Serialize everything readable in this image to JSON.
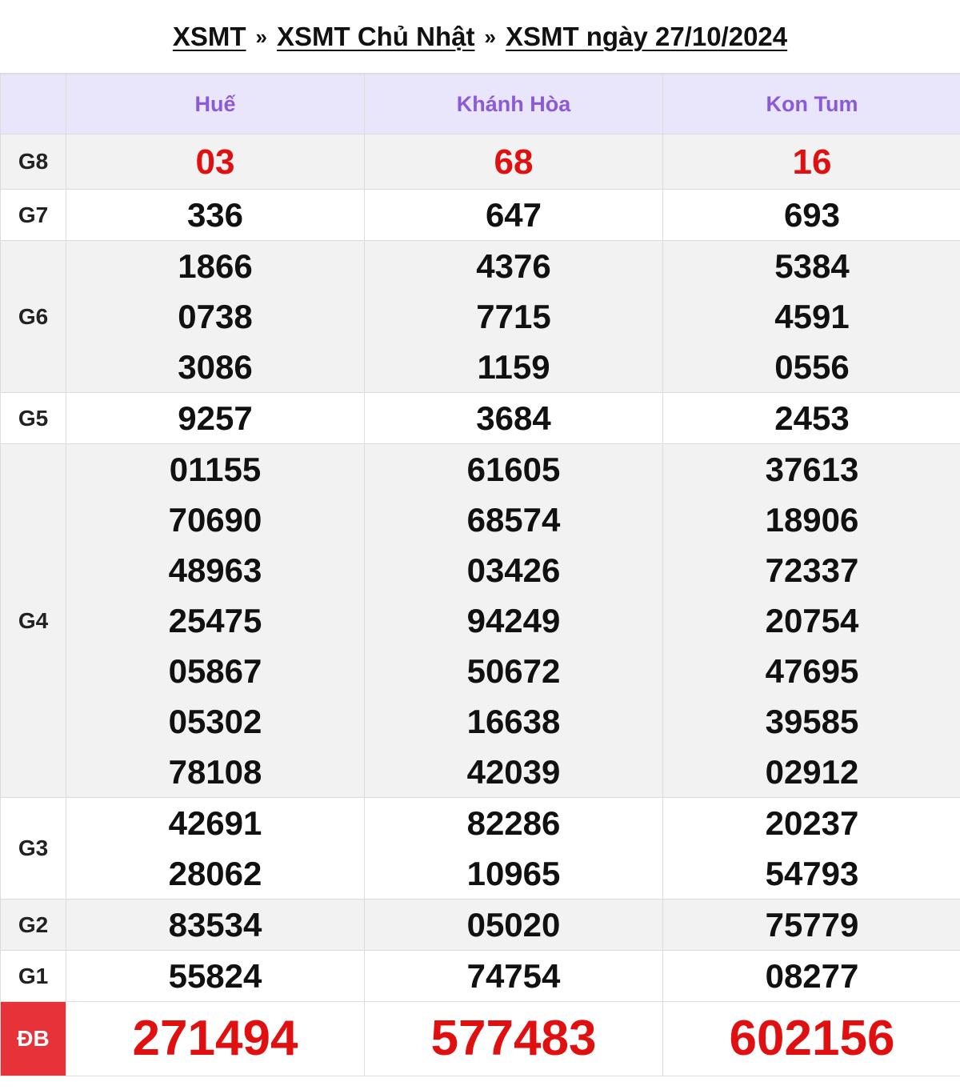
{
  "breadcrumb": {
    "item1": "XSMT",
    "sep": "»",
    "item2": "XSMT Chủ Nhật",
    "item3": "XSMT ngày 27/10/2024"
  },
  "provinces": [
    "Huế",
    "Khánh Hòa",
    "Kon Tum"
  ],
  "prizes": [
    {
      "label": "G8",
      "style": "red",
      "values": [
        [
          "03"
        ],
        [
          "68"
        ],
        [
          "16"
        ]
      ]
    },
    {
      "label": "G7",
      "style": "normal",
      "values": [
        [
          "336"
        ],
        [
          "647"
        ],
        [
          "693"
        ]
      ]
    },
    {
      "label": "G6",
      "style": "normal",
      "values": [
        [
          "1866",
          "0738",
          "3086"
        ],
        [
          "4376",
          "7715",
          "1159"
        ],
        [
          "5384",
          "4591",
          "0556"
        ]
      ]
    },
    {
      "label": "G5",
      "style": "normal",
      "values": [
        [
          "9257"
        ],
        [
          "3684"
        ],
        [
          "2453"
        ]
      ]
    },
    {
      "label": "G4",
      "style": "normal",
      "values": [
        [
          "01155",
          "70690",
          "48963",
          "25475",
          "05867",
          "05302",
          "78108"
        ],
        [
          "61605",
          "68574",
          "03426",
          "94249",
          "50672",
          "16638",
          "42039"
        ],
        [
          "37613",
          "18906",
          "72337",
          "20754",
          "47695",
          "39585",
          "02912"
        ]
      ]
    },
    {
      "label": "G3",
      "style": "normal",
      "values": [
        [
          "42691",
          "28062"
        ],
        [
          "82286",
          "10965"
        ],
        [
          "20237",
          "54793"
        ]
      ]
    },
    {
      "label": "G2",
      "style": "normal",
      "values": [
        [
          "83534"
        ],
        [
          "05020"
        ],
        [
          "75779"
        ]
      ]
    },
    {
      "label": "G1",
      "style": "normal",
      "values": [
        [
          "55824"
        ],
        [
          "74754"
        ],
        [
          "08277"
        ]
      ]
    },
    {
      "label": "ĐB",
      "style": "db",
      "values": [
        [
          "271494"
        ],
        [
          "577483"
        ],
        [
          "602156"
        ]
      ]
    }
  ],
  "colors": {
    "header_bg": "#e9e6fb",
    "header_text": "#8b5ad6",
    "highlight_red": "#e01010",
    "db_label_bg": "#e8323a"
  }
}
